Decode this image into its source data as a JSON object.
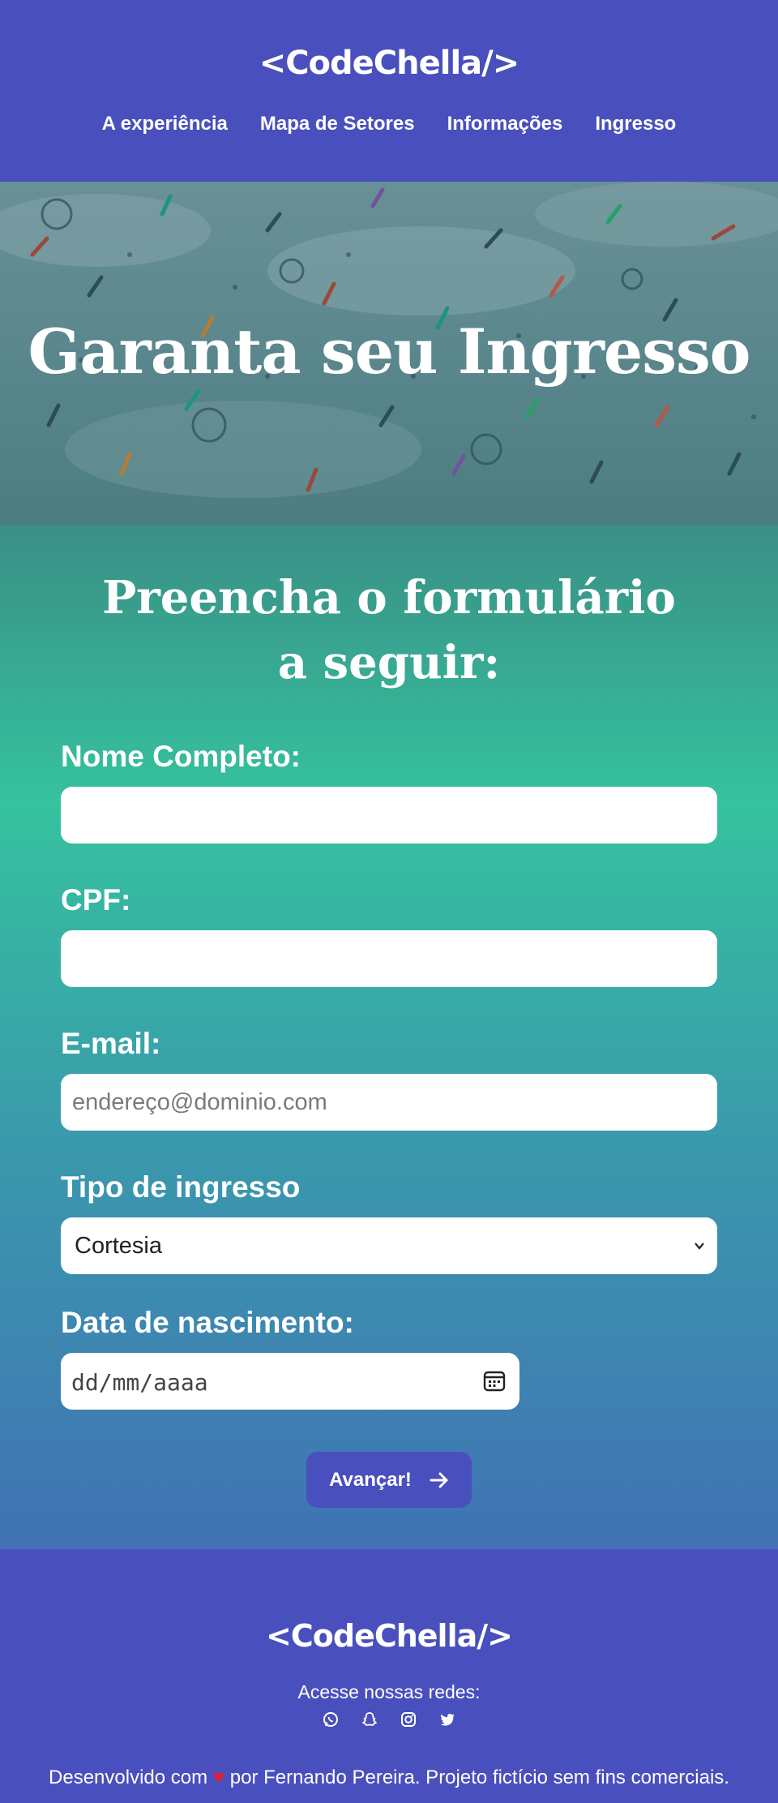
{
  "header": {
    "logo": "<CodeChella/>",
    "nav": [
      "A experiência",
      "Mapa de Setores",
      "Informações",
      "Ingresso"
    ]
  },
  "hero": {
    "title": "Garanta seu Ingresso"
  },
  "form": {
    "title": "Preencha o formulário a seguir:",
    "name_label": "Nome Completo:",
    "name_value": "",
    "cpf_label": "CPF:",
    "cpf_value": "",
    "email_label": "E-mail:",
    "email_placeholder": "endereço@dominio.com",
    "ticket_label": "Tipo de ingresso",
    "ticket_selected": "Cortesia",
    "birth_label": "Data de nascimento:",
    "birth_placeholder": "dd/mm/aaaa",
    "submit_label": "Avançar!"
  },
  "footer": {
    "logo": "<CodeChella/>",
    "social_text": "Acesse nossas redes:",
    "social_icons": [
      "whatsapp-icon",
      "snapchat-icon",
      "instagram-icon",
      "twitter-icon"
    ],
    "credit_before": "Desenvolvido com",
    "credit_heart": "♥",
    "credit_after": "por Fernando Pereira. Projeto fictício sem fins comerciais."
  },
  "colors": {
    "brand": "#4950bd",
    "form_gradient_top": "#3a8f85",
    "form_gradient_mid": "#35c29e",
    "form_gradient_bottom": "#4172b5",
    "heart": "#e01f2a"
  }
}
